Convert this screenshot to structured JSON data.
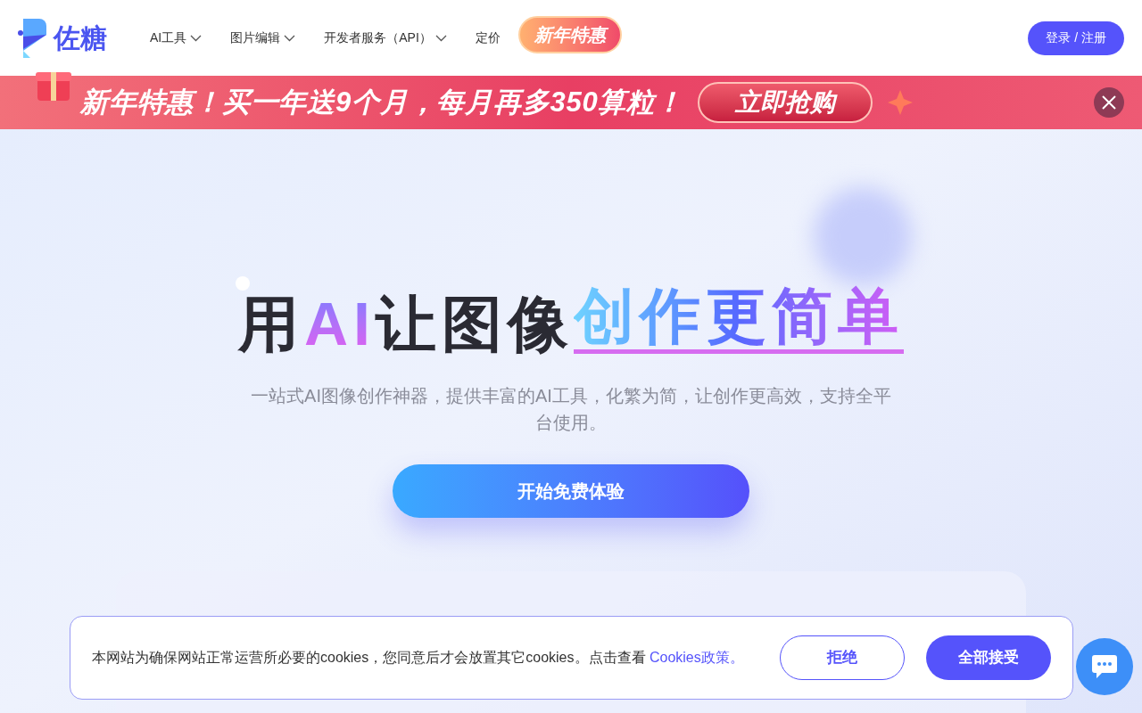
{
  "header": {
    "logo_text": "佐糖",
    "nav": [
      {
        "label": "AI工具",
        "has_dropdown": true
      },
      {
        "label": "图片编辑",
        "has_dropdown": true
      },
      {
        "label": "开发者服务（API）",
        "has_dropdown": true
      },
      {
        "label": "定价",
        "has_dropdown": false
      }
    ],
    "promo_badge": "新年特惠",
    "login_button": "登录 / 注册"
  },
  "banner": {
    "headline": "新年特惠！买一年送9个月，每月再多350算粒！",
    "button": "立即抢购"
  },
  "hero": {
    "title_parts": [
      {
        "text": "用",
        "kind": "plain"
      },
      {
        "text": "AI",
        "kind": "gradient"
      },
      {
        "text": "让图像",
        "kind": "plain"
      },
      {
        "text": "创作更简单",
        "kind": "underlined"
      }
    ],
    "subtitle": "一站式AI图像创作神器，提供丰富的AI工具，化繁为简，让创作更高效，支持全平台使用。",
    "cta": "开始免费体验"
  },
  "cookie_bar": {
    "text": "本网站为确保网站正常运营所必要的cookies，您同意后才会放置其它cookies。点击查看",
    "link": "Cookies政策。",
    "reject": "拒绝",
    "accept": "全部接受"
  }
}
